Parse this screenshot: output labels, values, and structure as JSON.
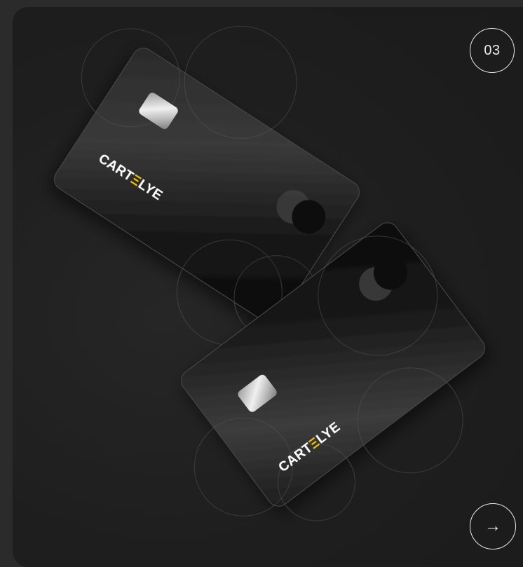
{
  "slide": {
    "number": "03"
  },
  "navigation": {
    "next_icon": "arrow-right-icon",
    "next_glyph": "→"
  },
  "cards": [
    {
      "brand_prefix": "CART",
      "brand_mark": "Ξ",
      "brand_suffix": "LYE"
    },
    {
      "brand_prefix": "CART",
      "brand_mark": "Ξ",
      "brand_suffix": "LYE"
    }
  ],
  "colors": {
    "background": "#2b2b2b",
    "panel": "#1e1e1e",
    "card": "#141414",
    "accent": "#f2c200",
    "text": "#eaeaea"
  }
}
